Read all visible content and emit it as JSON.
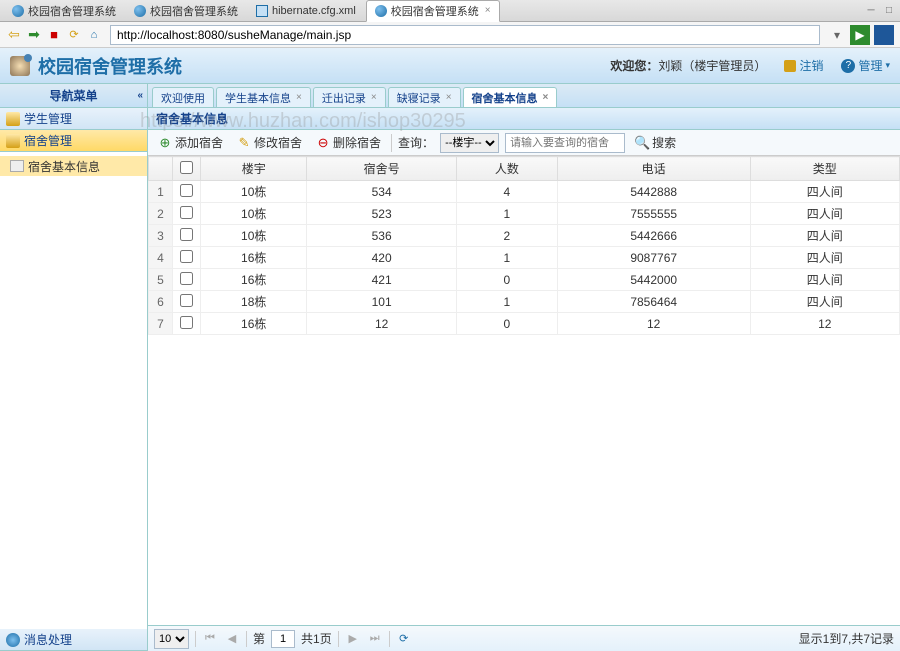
{
  "ide_tabs": [
    {
      "label": "校园宿舍管理系统",
      "active": false
    },
    {
      "label": "校园宿舍管理系统",
      "active": false
    },
    {
      "label": "hibernate.cfg.xml",
      "active": false,
      "icon": "xml"
    },
    {
      "label": "校园宿舍管理系统",
      "active": true
    }
  ],
  "url": "http://localhost:8080/susheManage/main.jsp",
  "app_title": "校园宿舍管理系统",
  "welcome_prefix": "欢迎您：",
  "welcome_user": "刘颖（楼宇管理员）",
  "header_links": {
    "logout": "注销",
    "manage": "管理"
  },
  "sidebar_title": "导航菜单",
  "accordion": [
    {
      "label": "学生管理",
      "icon": "folder",
      "active": false
    },
    {
      "label": "宿舍管理",
      "icon": "folder",
      "active": true
    },
    {
      "label": "消息处理",
      "icon": "msg",
      "active": false
    }
  ],
  "tree_items": [
    {
      "label": "宿舍基本信息",
      "selected": true
    }
  ],
  "tabs": [
    {
      "label": "欢迎使用",
      "closable": false,
      "active": false
    },
    {
      "label": "学生基本信息",
      "closable": true,
      "active": false
    },
    {
      "label": "迁出记录",
      "closable": true,
      "active": false
    },
    {
      "label": "缺寝记录",
      "closable": true,
      "active": false
    },
    {
      "label": "宿舍基本信息",
      "closable": true,
      "active": true
    }
  ],
  "panel_title": "宿舍基本信息",
  "toolbar": {
    "add": "添加宿舍",
    "edit": "修改宿舍",
    "del": "删除宿舍",
    "query_label": "查询：",
    "query_select": "--楼宇--",
    "query_placeholder": "请输入要查询的宿舍",
    "search": "搜索"
  },
  "columns": [
    "楼宇",
    "宿舍号",
    "人数",
    "电话",
    "类型"
  ],
  "rows": [
    {
      "n": 1,
      "b": "10栋",
      "r": "534",
      "p": "4",
      "t": "5442888",
      "ty": "四人间"
    },
    {
      "n": 2,
      "b": "10栋",
      "r": "523",
      "p": "1",
      "t": "7555555",
      "ty": "四人间"
    },
    {
      "n": 3,
      "b": "10栋",
      "r": "536",
      "p": "2",
      "t": "5442666",
      "ty": "四人间"
    },
    {
      "n": 4,
      "b": "16栋",
      "r": "420",
      "p": "1",
      "t": "9087767",
      "ty": "四人间"
    },
    {
      "n": 5,
      "b": "16栋",
      "r": "421",
      "p": "0",
      "t": "5442000",
      "ty": "四人间"
    },
    {
      "n": 6,
      "b": "18栋",
      "r": "101",
      "p": "1",
      "t": "7856464",
      "ty": "四人间"
    },
    {
      "n": 7,
      "b": "16栋",
      "r": "12",
      "p": "0",
      "t": "12",
      "ty": "12"
    }
  ],
  "pagination": {
    "size": "10",
    "page_prefix": "第",
    "page": "1",
    "total_pages": "共1页",
    "info": "显示1到7,共7记录"
  },
  "watermark": "https://www.huzhan.com/ishop30295"
}
